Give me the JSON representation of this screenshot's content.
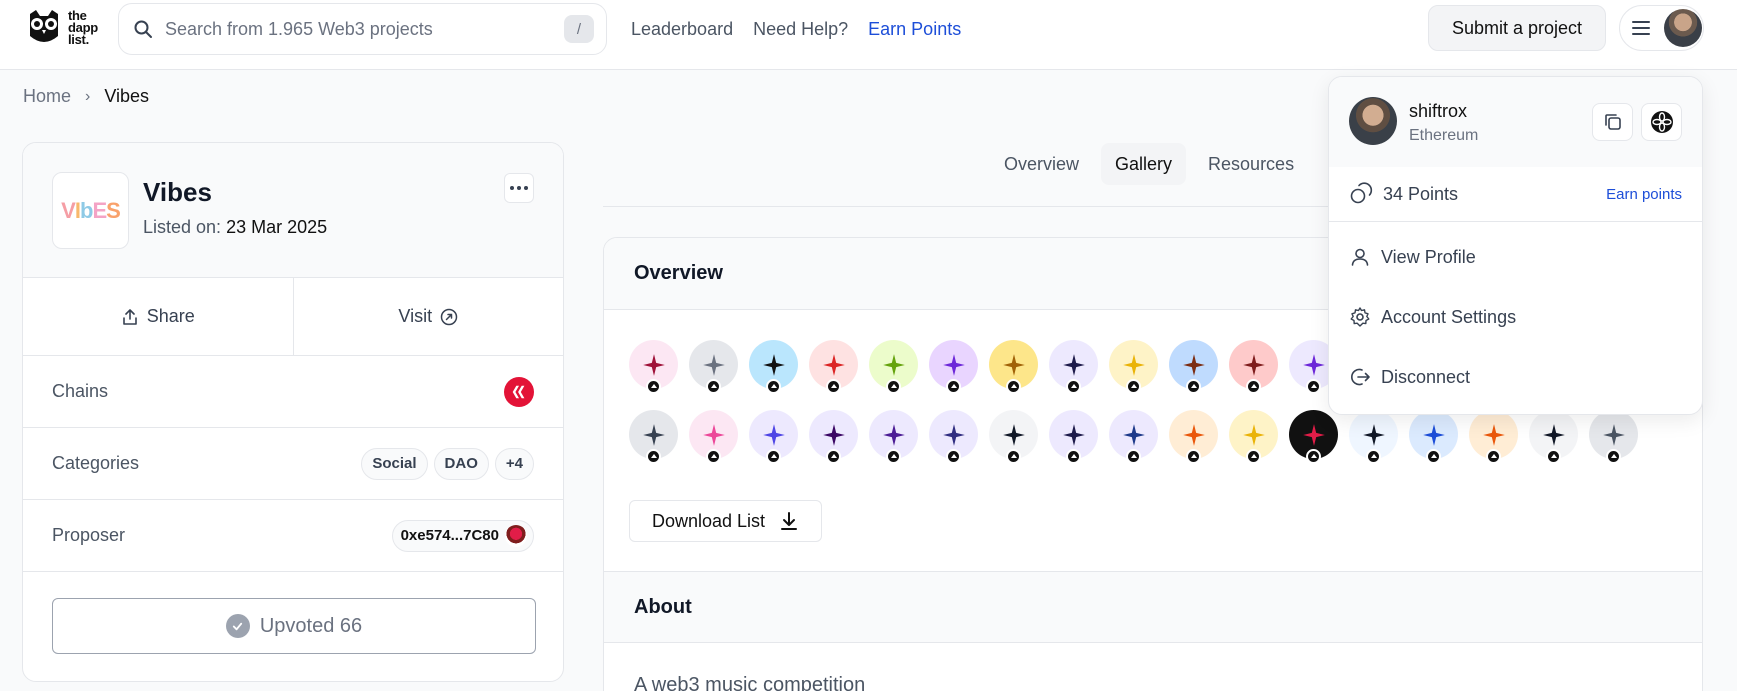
{
  "header": {
    "logo_text": [
      "the",
      "dapp",
      "list."
    ],
    "search_placeholder": "Search from 1.965 Web3 projects",
    "search_shortcut": "/",
    "nav": [
      "Leaderboard",
      "Need Help?",
      "Earn Points"
    ],
    "submit_label": "Submit a project"
  },
  "breadcrumb": {
    "home": "Home",
    "current": "Vibes"
  },
  "project": {
    "name": "Vibes",
    "logo_text": "VIbES",
    "listed_label": "Listed on:",
    "listed_date": "23 Mar 2025",
    "share_label": "Share",
    "visit_label": "Visit",
    "chains_label": "Chains",
    "categories_label": "Categories",
    "categories": [
      "Social",
      "DAO",
      "+4"
    ],
    "proposer_label": "Proposer",
    "proposer_address": "0xe574...7C80",
    "upvote_label": "Upvoted 66"
  },
  "tabs": [
    "Overview",
    "Gallery",
    "Resources"
  ],
  "overview": {
    "title": "Overview",
    "download_label": "Download List",
    "about_title": "About",
    "about_text": "A web3 music competition"
  },
  "dropdown": {
    "user_name": "shiftrox",
    "chain": "Ethereum",
    "points": "34 Points",
    "earn_points": "Earn points",
    "items": [
      "View Profile",
      "Account Settings",
      "Disconnect"
    ]
  },
  "colors": {
    "accent": "#1d4ed8",
    "hive_red": "#e31337",
    "border": "#e5e7eb"
  }
}
